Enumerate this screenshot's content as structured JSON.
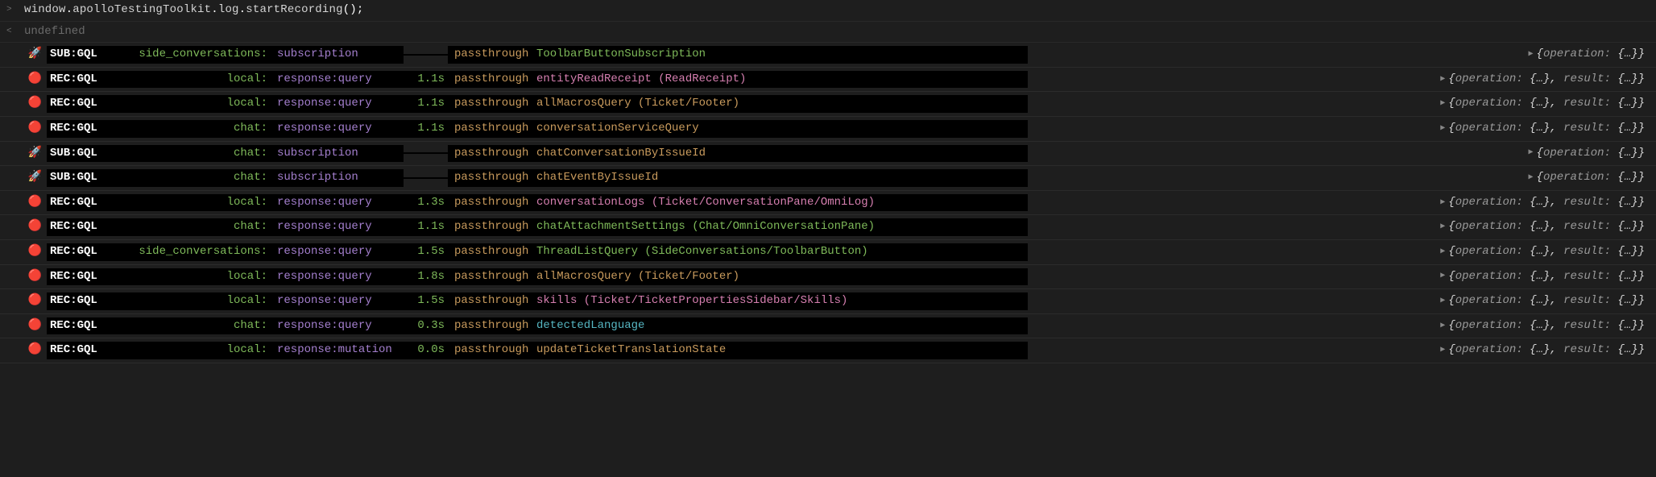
{
  "input": {
    "prompt": ">",
    "code_parts": {
      "p1": "window",
      "dot1": ".",
      "p2": "apolloTestingToolkit",
      "dot2": ".",
      "p3": "log",
      "dot3": ".",
      "p4": "startRecording",
      "paren": "();"
    }
  },
  "result": {
    "prompt": "<",
    "text": "undefined"
  },
  "rows": [
    {
      "icon": "🚀",
      "tag": "SUB:GQL",
      "label": "side_conversations:",
      "kind": "subscription",
      "time": "",
      "mode": "passthrough",
      "name": "ToolbarButtonSubscription",
      "name_class": "c-green",
      "expand": "short"
    },
    {
      "icon": "🔴",
      "tag": "REC:GQL",
      "label": "local:",
      "kind": "response:query",
      "time": "1.1s",
      "mode": "passthrough",
      "name": "entityReadReceipt (ReadReceipt)",
      "name_class": "c-pink",
      "expand": "long"
    },
    {
      "icon": "🔴",
      "tag": "REC:GQL",
      "label": "local:",
      "kind": "response:query",
      "time": "1.1s",
      "mode": "passthrough",
      "name": "allMacrosQuery (Ticket/Footer)",
      "name_class": "c-orange",
      "expand": "long"
    },
    {
      "icon": "🔴",
      "tag": "REC:GQL",
      "label": "chat:",
      "kind": "response:query",
      "time": "1.1s",
      "mode": "passthrough",
      "name": "conversationServiceQuery",
      "name_class": "c-orange",
      "expand": "long"
    },
    {
      "icon": "🚀",
      "tag": "SUB:GQL",
      "label": "chat:",
      "kind": "subscription",
      "time": "",
      "mode": "passthrough",
      "name": "chatConversationByIssueId",
      "name_class": "c-orange",
      "expand": "short"
    },
    {
      "icon": "🚀",
      "tag": "SUB:GQL",
      "label": "chat:",
      "kind": "subscription",
      "time": "",
      "mode": "passthrough",
      "name": "chatEventByIssueId",
      "name_class": "c-orange",
      "expand": "short"
    },
    {
      "icon": "🔴",
      "tag": "REC:GQL",
      "label": "local:",
      "kind": "response:query",
      "time": "1.3s",
      "mode": "passthrough",
      "name": "conversationLogs (Ticket/ConversationPane/OmniLog)",
      "name_class": "c-pink",
      "expand": "long"
    },
    {
      "icon": "🔴",
      "tag": "REC:GQL",
      "label": "chat:",
      "kind": "response:query",
      "time": "1.1s",
      "mode": "passthrough",
      "name": "chatAttachmentSettings (Chat/OmniConversationPane)",
      "name_class": "c-green",
      "expand": "long"
    },
    {
      "icon": "🔴",
      "tag": "REC:GQL",
      "label": "side_conversations:",
      "kind": "response:query",
      "time": "1.5s",
      "mode": "passthrough",
      "name": "ThreadListQuery (SideConversations/ToolbarButton)",
      "name_class": "c-green",
      "expand": "long"
    },
    {
      "icon": "🔴",
      "tag": "REC:GQL",
      "label": "local:",
      "kind": "response:query",
      "time": "1.8s",
      "mode": "passthrough",
      "name": "allMacrosQuery (Ticket/Footer)",
      "name_class": "c-orange",
      "expand": "long"
    },
    {
      "icon": "🔴",
      "tag": "REC:GQL",
      "label": "local:",
      "kind": "response:query",
      "time": "1.5s",
      "mode": "passthrough",
      "name": "skills (Ticket/TicketPropertiesSidebar/Skills)",
      "name_class": "c-pink",
      "expand": "long"
    },
    {
      "icon": "🔴",
      "tag": "REC:GQL",
      "label": "chat:",
      "kind": "response:query",
      "time": "0.3s",
      "mode": "passthrough",
      "name": "detectedLanguage",
      "name_class": "c-cyan",
      "expand": "long"
    },
    {
      "icon": "🔴",
      "tag": "REC:GQL",
      "label": "local:",
      "kind": "response:mutation",
      "time": "0.0s",
      "mode": "passthrough",
      "name": "updateTicketTranslationState",
      "name_class": "c-orange",
      "expand": "long"
    }
  ],
  "expand_labels": {
    "arrow": "▶",
    "op_key": "operation:",
    "res_key": "result:",
    "obj": "{…}",
    "comma": ", "
  }
}
